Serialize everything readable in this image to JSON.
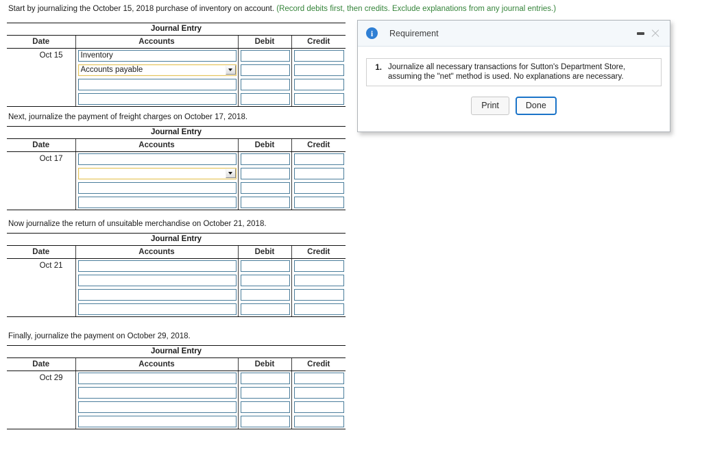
{
  "page": {
    "intro": {
      "lead": "Start by journalizing the October 15, 2018 purchase of inventory on account. ",
      "note": "(Record debits first, then credits. Exclude explanations from any journal entries.)"
    },
    "table_title": "Journal Entry",
    "columns": {
      "date": "Date",
      "accounts": "Accounts",
      "debit": "Debit",
      "credit": "Credit"
    },
    "sections": [
      {
        "label": "",
        "title": "Journal Entry",
        "date": "Oct 15",
        "rows": [
          {
            "account": "Inventory",
            "type": "text",
            "debit": "",
            "credit": ""
          },
          {
            "account": "Accounts payable",
            "type": "combo",
            "debit": "",
            "credit": ""
          },
          {
            "account": "",
            "type": "text",
            "debit": "",
            "credit": ""
          },
          {
            "account": "",
            "type": "text",
            "debit": "",
            "credit": ""
          }
        ]
      },
      {
        "label": "Next, journalize the payment of freight charges on October 17, 2018.",
        "title": "Journal Entry",
        "date": "Oct 17",
        "rows": [
          {
            "account": "",
            "type": "text",
            "debit": "",
            "credit": ""
          },
          {
            "account": "",
            "type": "combo",
            "debit": "",
            "credit": ""
          },
          {
            "account": "",
            "type": "text",
            "debit": "",
            "credit": ""
          },
          {
            "account": "",
            "type": "text",
            "debit": "",
            "credit": ""
          }
        ]
      },
      {
        "label": "Now journalize the return of unsuitable merchandise on October 21, 2018.",
        "title": "Journal Entry",
        "date": "Oct 21",
        "rows": [
          {
            "account": "",
            "type": "text",
            "debit": "",
            "credit": ""
          },
          {
            "account": "",
            "type": "text",
            "debit": "",
            "credit": ""
          },
          {
            "account": "",
            "type": "text",
            "debit": "",
            "credit": ""
          },
          {
            "account": "",
            "type": "text",
            "debit": "",
            "credit": ""
          }
        ]
      },
      {
        "label": "Finally, journalize the payment on October 29, 2018.",
        "title": "Journal Entry",
        "date": "Oct 29",
        "rows": [
          {
            "account": "",
            "type": "text",
            "debit": "",
            "credit": ""
          },
          {
            "account": "",
            "type": "text",
            "debit": "",
            "credit": ""
          },
          {
            "account": "",
            "type": "text",
            "debit": "",
            "credit": ""
          },
          {
            "account": "",
            "type": "text",
            "debit": "",
            "credit": ""
          }
        ]
      }
    ]
  },
  "dialog": {
    "icon": "info-icon",
    "title": "Requirement",
    "minimize_label": "minimize-icon",
    "close_label": "close-icon",
    "requirements": [
      {
        "number": "1.",
        "text": "Journalize all necessary transactions for Sutton's Department Store, assuming the \"net\" method is used. No explanations are necessary."
      }
    ],
    "buttons": {
      "print": "Print",
      "done": "Done"
    }
  },
  "colors": {
    "input_border": "#4a7d9b",
    "combo_border": "#e3c25c",
    "note_green": "#35843a",
    "dialog_accent": "#1a73c8",
    "info_blue": "#2f7fd4"
  }
}
